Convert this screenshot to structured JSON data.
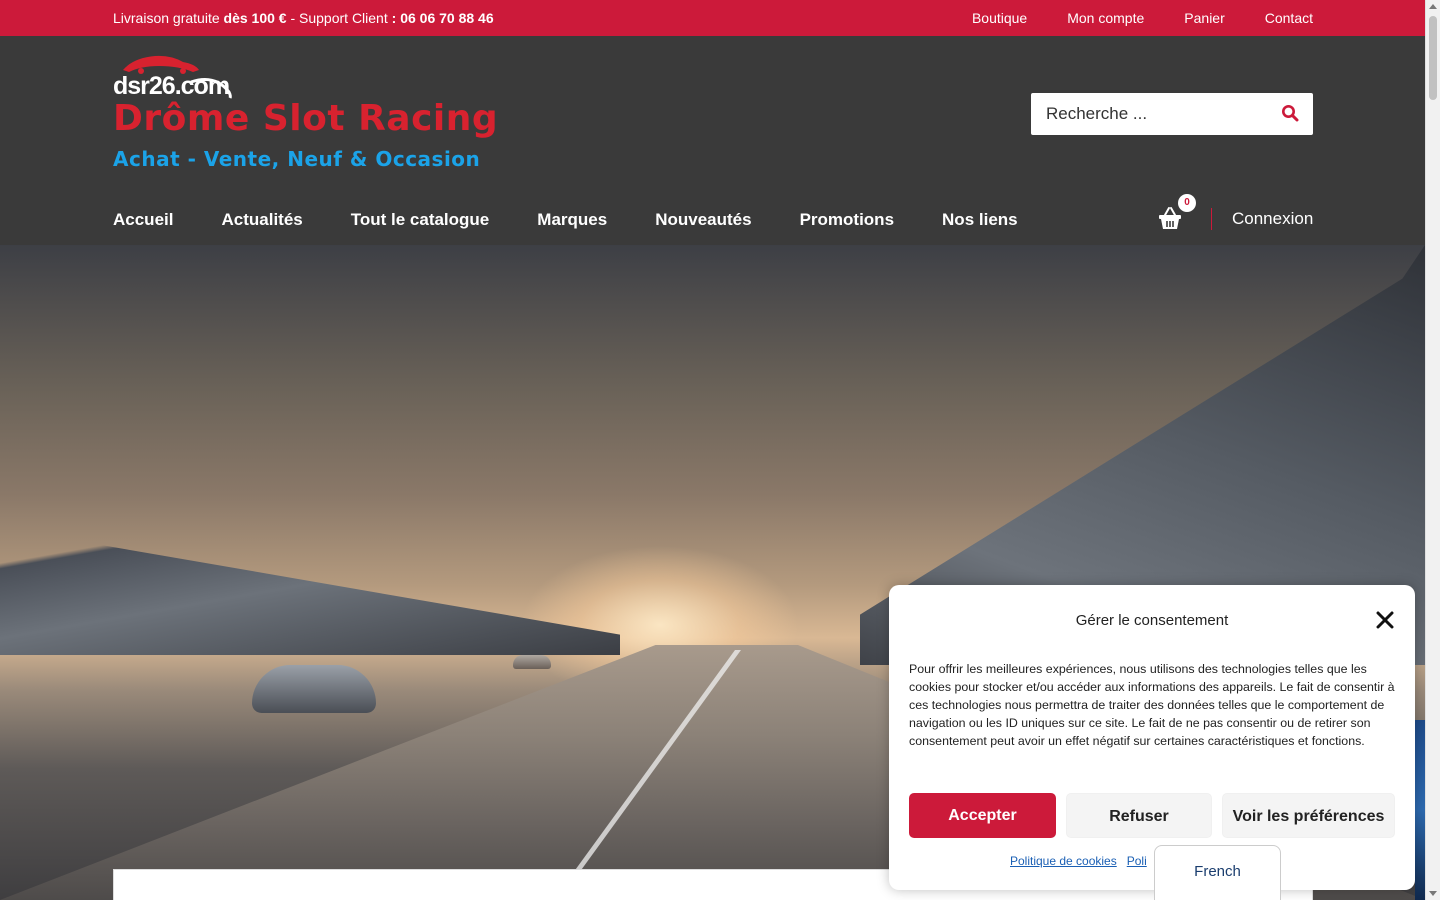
{
  "topbar": {
    "shipping_prefix": "Livraison gratuite ",
    "shipping_amount": "dès 100 €",
    "support_label": " - Support Client  ",
    "support_phone": ": 06 06 70 88 46",
    "links": [
      "Boutique",
      "Mon compte",
      "Panier",
      "Contact"
    ]
  },
  "header": {
    "logo_text": "dsr26.com",
    "site_title": "Drôme Slot Racing",
    "site_subtitle": "Achat - Vente, Neuf & Occasion",
    "search_placeholder": "Recherche ...",
    "cart_count": "0",
    "login_label": "Connexion"
  },
  "nav": {
    "items": [
      "Accueil",
      "Actualités",
      "Tout le catalogue",
      "Marques",
      "Nouveautés",
      "Promotions",
      "Nos liens"
    ]
  },
  "consent": {
    "title": "Gérer le consentement",
    "body": "Pour offrir les meilleures expériences, nous utilisons des technologies telles que les cookies pour stocker et/ou accéder aux informations des appareils. Le fait de consentir à ces technologies nous permettra de traiter des données telles que le comportement de navigation ou les ID uniques sur ce site. Le fait de ne pas consentir ou de retirer son consentement peut avoir un effet négatif sur certaines caractéristiques et fonctions.",
    "accept_label": "Accepter",
    "refuse_label": "Refuser",
    "prefs_label": "Voir les préférences",
    "link_cookies": "Politique de cookies",
    "link_privacy": "Poli"
  },
  "language": {
    "selected": "French"
  },
  "colors": {
    "brand_red": "#cc1a3a",
    "title_red": "#d8222f",
    "subtitle_blue": "#1ba3e8",
    "header_bg": "#3a3a3a"
  }
}
